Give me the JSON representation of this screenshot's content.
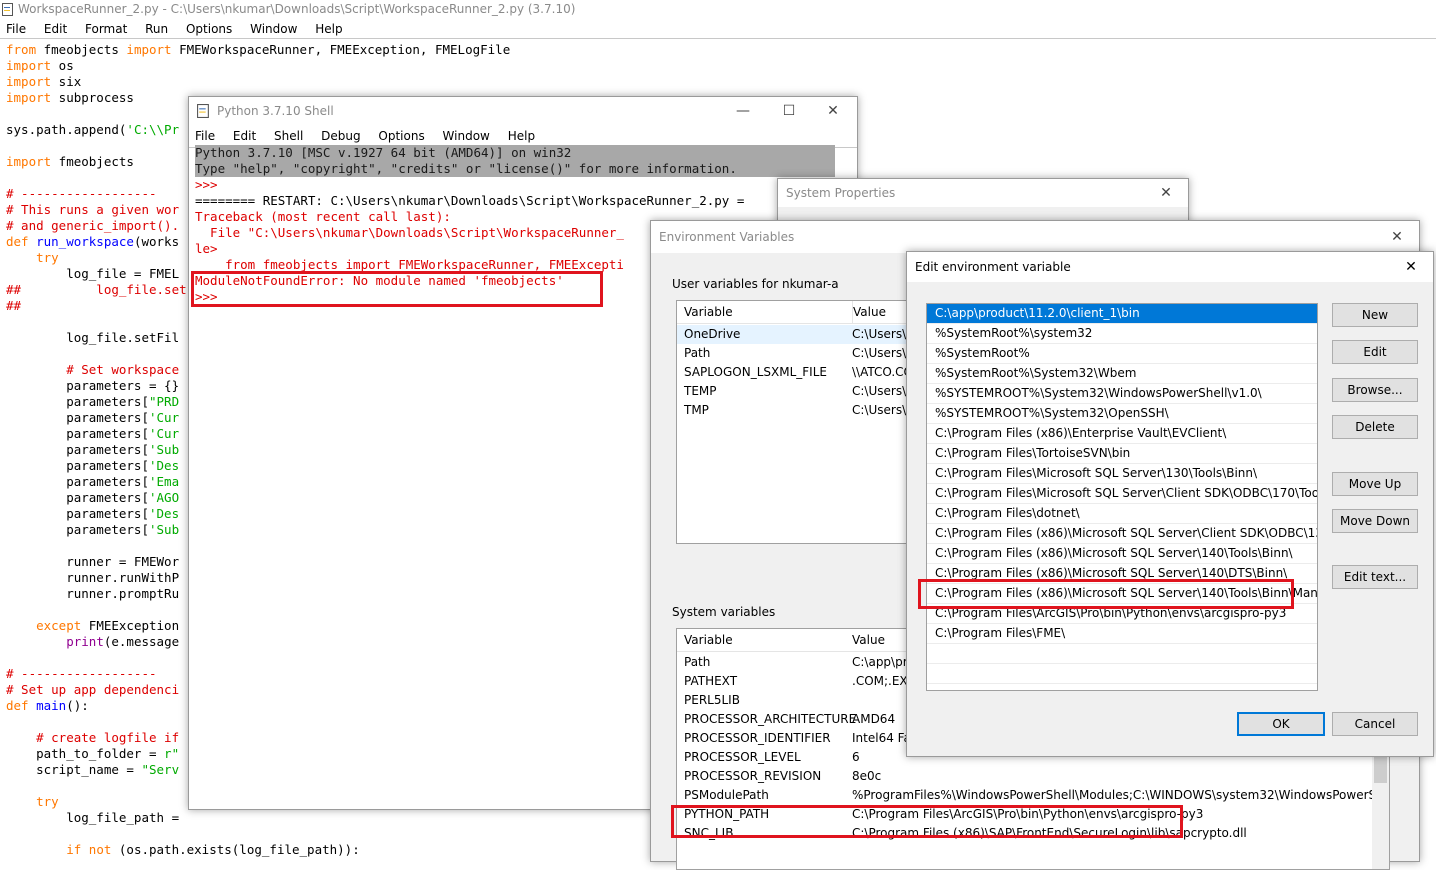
{
  "editor": {
    "title": "WorkspaceRunner_2.py - C:\\Users\\nkumar\\Downloads\\Script\\WorkspaceRunner_2.py (3.7.10)",
    "menu": [
      "File",
      "Edit",
      "Format",
      "Run",
      "Options",
      "Window",
      "Help"
    ]
  },
  "shell": {
    "title": "Python 3.7.10 Shell",
    "menu": [
      "File",
      "Edit",
      "Shell",
      "Debug",
      "Options",
      "Window",
      "Help"
    ],
    "lines": {
      "l1": "Python 3.7.10 [MSC v.1927 64 bit (AMD64)] on win32",
      "l2": "Type \"help\", \"copyright\", \"credits\" or \"license()\" for more information.",
      "l3": ">>> ",
      "l4": "======== RESTART: C:\\Users\\nkumar\\Downloads\\Script\\WorkspaceRunner_2.py =",
      "l5": "Traceback (most recent call last):",
      "l6": "  File \"C:\\Users\\nkumar\\Downloads\\Script\\WorkspaceRunner_",
      "l7": "le>",
      "l8": "    from fmeobjects import FMEWorkspaceRunner, FMEExcepti",
      "l9": "ModuleNotFoundError: No module named 'fmeobjects'",
      "l10": ">>> "
    }
  },
  "sysprops": {
    "title": "System Properties"
  },
  "envvars": {
    "title": "Environment Variables",
    "user_label": "User variables for nkumar-a",
    "system_label": "System variables",
    "col_variable": "Variable",
    "col_value": "Value",
    "user_vars": [
      {
        "name": "OneDrive",
        "value": "C:\\Users\\n"
      },
      {
        "name": "Path",
        "value": "C:\\Users\\n"
      },
      {
        "name": "SAPLOGON_LSXML_FILE",
        "value": "\\\\ATCO.CO"
      },
      {
        "name": "TEMP",
        "value": "C:\\Users\\n"
      },
      {
        "name": "TMP",
        "value": "C:\\Users\\n"
      }
    ],
    "system_vars": [
      {
        "name": "Path",
        "value": "C:\\app\\pr"
      },
      {
        "name": "PATHEXT",
        "value": ".COM;.EXE"
      },
      {
        "name": "PERL5LIB",
        "value": ""
      },
      {
        "name": "PROCESSOR_ARCHITECTURE",
        "value": "AMD64"
      },
      {
        "name": "PROCESSOR_IDENTIFIER",
        "value": "Intel64 Fam"
      },
      {
        "name": "PROCESSOR_LEVEL",
        "value": "6"
      },
      {
        "name": "PROCESSOR_REVISION",
        "value": "8e0c"
      },
      {
        "name": "PSModulePath",
        "value": "%ProgramFiles%\\WindowsPowerShell\\Modules;C:\\WINDOWS\\system32\\WindowsPowerShell\\v..."
      },
      {
        "name": "PYTHON_PATH",
        "value": "C:\\Program Files\\ArcGIS\\Pro\\bin\\Python\\envs\\arcgispro-py3"
      },
      {
        "name": "SNC_LIB",
        "value": "C:\\Program Files (x86)\\SAP\\FrontEnd\\SecureLogin\\lib\\sapcrypto.dll"
      }
    ]
  },
  "editenv": {
    "title": "Edit environment variable",
    "paths": [
      "C:\\app\\product\\11.2.0\\client_1\\bin",
      "%SystemRoot%\\system32",
      "%SystemRoot%",
      "%SystemRoot%\\System32\\Wbem",
      "%SYSTEMROOT%\\System32\\WindowsPowerShell\\v1.0\\",
      "%SYSTEMROOT%\\System32\\OpenSSH\\",
      "C:\\Program Files (x86)\\Enterprise Vault\\EVClient\\",
      "C:\\Program Files\\TortoiseSVN\\bin",
      "C:\\Program Files\\Microsoft SQL Server\\130\\Tools\\Binn\\",
      "C:\\Program Files\\Microsoft SQL Server\\Client SDK\\ODBC\\170\\Tools\\Bi...",
      "C:\\Program Files\\dotnet\\",
      "C:\\Program Files (x86)\\Microsoft SQL Server\\Client SDK\\ODBC\\130\\To...",
      "C:\\Program Files (x86)\\Microsoft SQL Server\\140\\Tools\\Binn\\",
      "C:\\Program Files (x86)\\Microsoft SQL Server\\140\\DTS\\Binn\\",
      "C:\\Program Files (x86)\\Microsoft SQL Server\\140\\Tools\\Binn\\Manage...",
      "C:\\Program Files\\ArcGIS\\Pro\\bin\\Python\\envs\\arcgispro-py3",
      "C:\\Program Files\\FME\\"
    ],
    "buttons": {
      "new": "New",
      "edit": "Edit",
      "browse": "Browse...",
      "delete": "Delete",
      "move_up": "Move Up",
      "move_down": "Move Down",
      "edit_text": "Edit text...",
      "ok": "OK",
      "cancel": "Cancel"
    }
  },
  "code": {
    "c1a": "from",
    "c1b": " fmeobjects ",
    "c1c": "import",
    "c1d": " FMEWorkspaceRunner, FMEException, FMELogFile",
    "c2a": "import",
    "c2b": " os",
    "c3a": "import",
    "c3b": " six",
    "c4a": "import",
    "c4b": " subprocess",
    "c6a": "sys.path.append(",
    "c6b": "'C:\\\\Pr",
    "c8a": "import",
    "c8b": " fmeobjects",
    "c10": "# ------------------",
    "c11": "# This runs a given wor",
    "c12": "# and generic_import().",
    "c13a": "def",
    "c13b": " run_workspace",
    "c13c": "(works",
    "c14a": "    ",
    "c14b": "try",
    "c15": "        log_file = FMEL",
    "c16": "##          log_file.setF",
    "c17": "##",
    "c19": "        log_file.setFil",
    "c21": "        # Set workspace",
    "c22": "        parameters = {}",
    "c23a": "        parameters[",
    "c23b": "\"PRD",
    "c24a": "        parameters[",
    "c24b": "'Cur",
    "c25a": "        parameters[",
    "c25b": "'Cur",
    "c26a": "        parameters[",
    "c26b": "'Sub",
    "c27a": "        parameters[",
    "c27b": "'Des",
    "c28a": "        parameters[",
    "c28b": "'Ema",
    "c29a": "        parameters[",
    "c29b": "'AGO",
    "c30a": "        parameters[",
    "c30b": "'Des",
    "c31a": "        parameters[",
    "c31b": "'Sub",
    "c33": "        runner = FMEWor",
    "c34": "        runner.runWithP",
    "c35": "        runner.promptRu",
    "c37a": "    ",
    "c37b": "except",
    "c37c": " FMEException",
    "c38a": "        ",
    "c38b": "print",
    "c38c": "(e.message",
    "c40": "# ------------------",
    "c41": "# Set up app dependenci",
    "c42a": "def",
    "c42b": " main",
    "c42c": "():",
    "c44": "    # create logfile if",
    "c45a": "    path_to_folder = ",
    "c45b": "r\"",
    "c46a": "    script_name = ",
    "c46b": "\"Serv",
    "c48a": "    ",
    "c48b": "try",
    "c49": "        log_file_path = ",
    "c51a": "        ",
    "c51b": "if not",
    "c51c": " (os.path.exists(log_file_path)):"
  }
}
